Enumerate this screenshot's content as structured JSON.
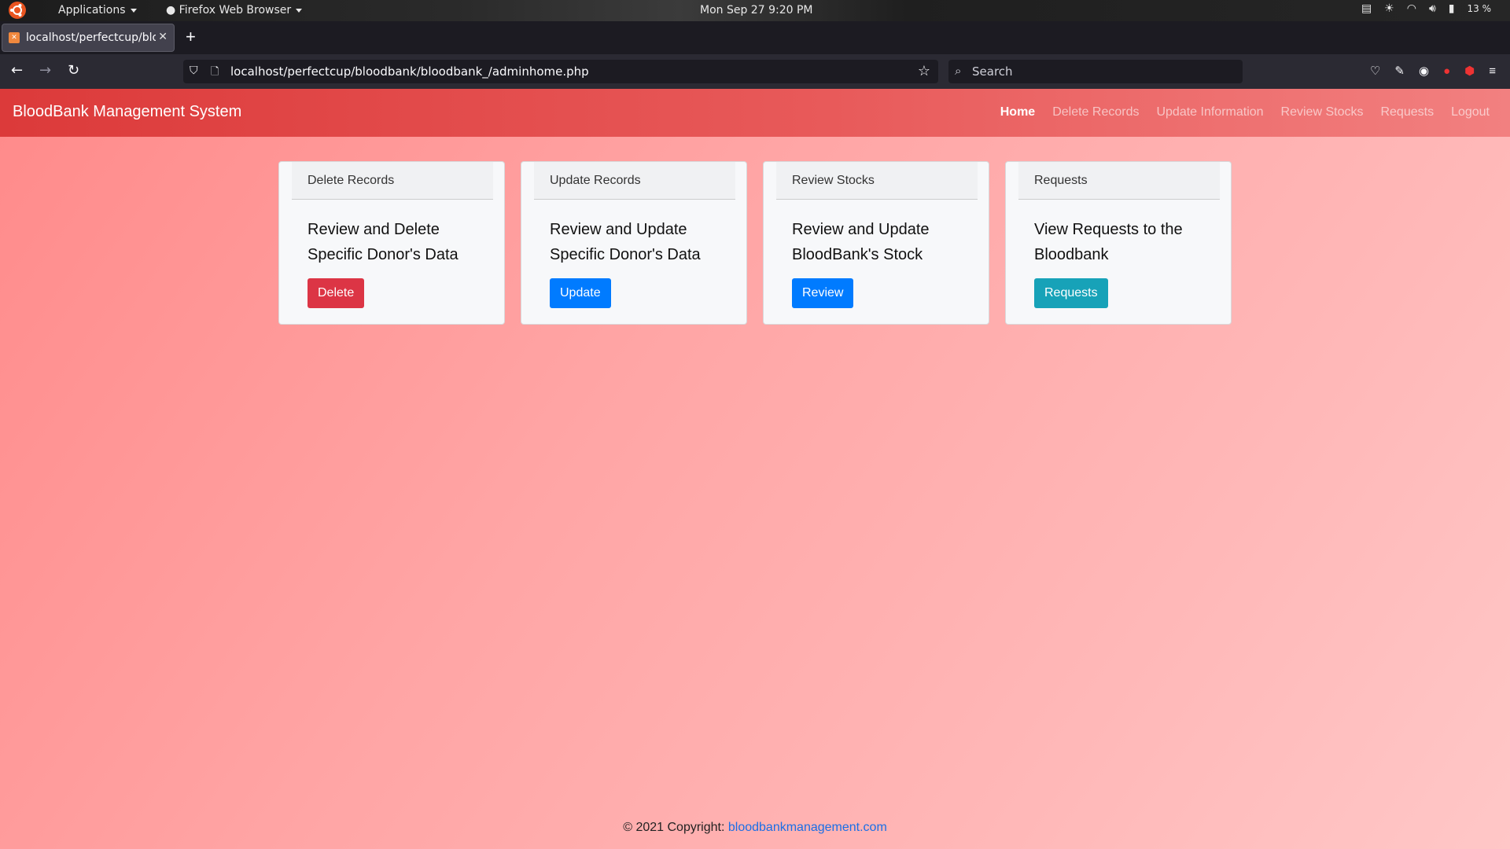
{
  "os_bar": {
    "applications": "Applications",
    "browser_app": "Firefox Web Browser",
    "clock": "Mon Sep 27   9:20 PM",
    "battery": "13 %"
  },
  "browser": {
    "tab_title": "localhost/perfectcup/bloodbank/bloodbank_/adminhome.php",
    "url": "localhost/perfectcup/bloodbank/bloodbank_/adminhome.php",
    "search_placeholder": "Search"
  },
  "app": {
    "brand": "BloodBank Management System",
    "nav": [
      "Home",
      "Delete Records",
      "Update Information",
      "Review Stocks",
      "Requests",
      "Logout"
    ],
    "active_nav": "Home"
  },
  "cards": [
    {
      "header": "Delete Records",
      "text": "Review and Delete Specific Donor's Data",
      "button": "Delete",
      "button_color": "#dc3545"
    },
    {
      "header": "Update Records",
      "text": "Review and Update Specific Donor's Data",
      "button": "Update",
      "button_color": "#007bff"
    },
    {
      "header": "Review Stocks",
      "text": "Review and Update BloodBank's Stock",
      "button": "Review",
      "button_color": "#007bff"
    },
    {
      "header": "Requests",
      "text": "View Requests to the Bloodbank",
      "button": "Requests",
      "button_color": "#17a2b8"
    }
  ],
  "footer": {
    "prefix": "© 2021 Copyright:",
    "link": "bloodbankmanagement.com"
  },
  "colors": {
    "navbar": "#dc3a3a",
    "page_bg": "#ffa5a5"
  }
}
